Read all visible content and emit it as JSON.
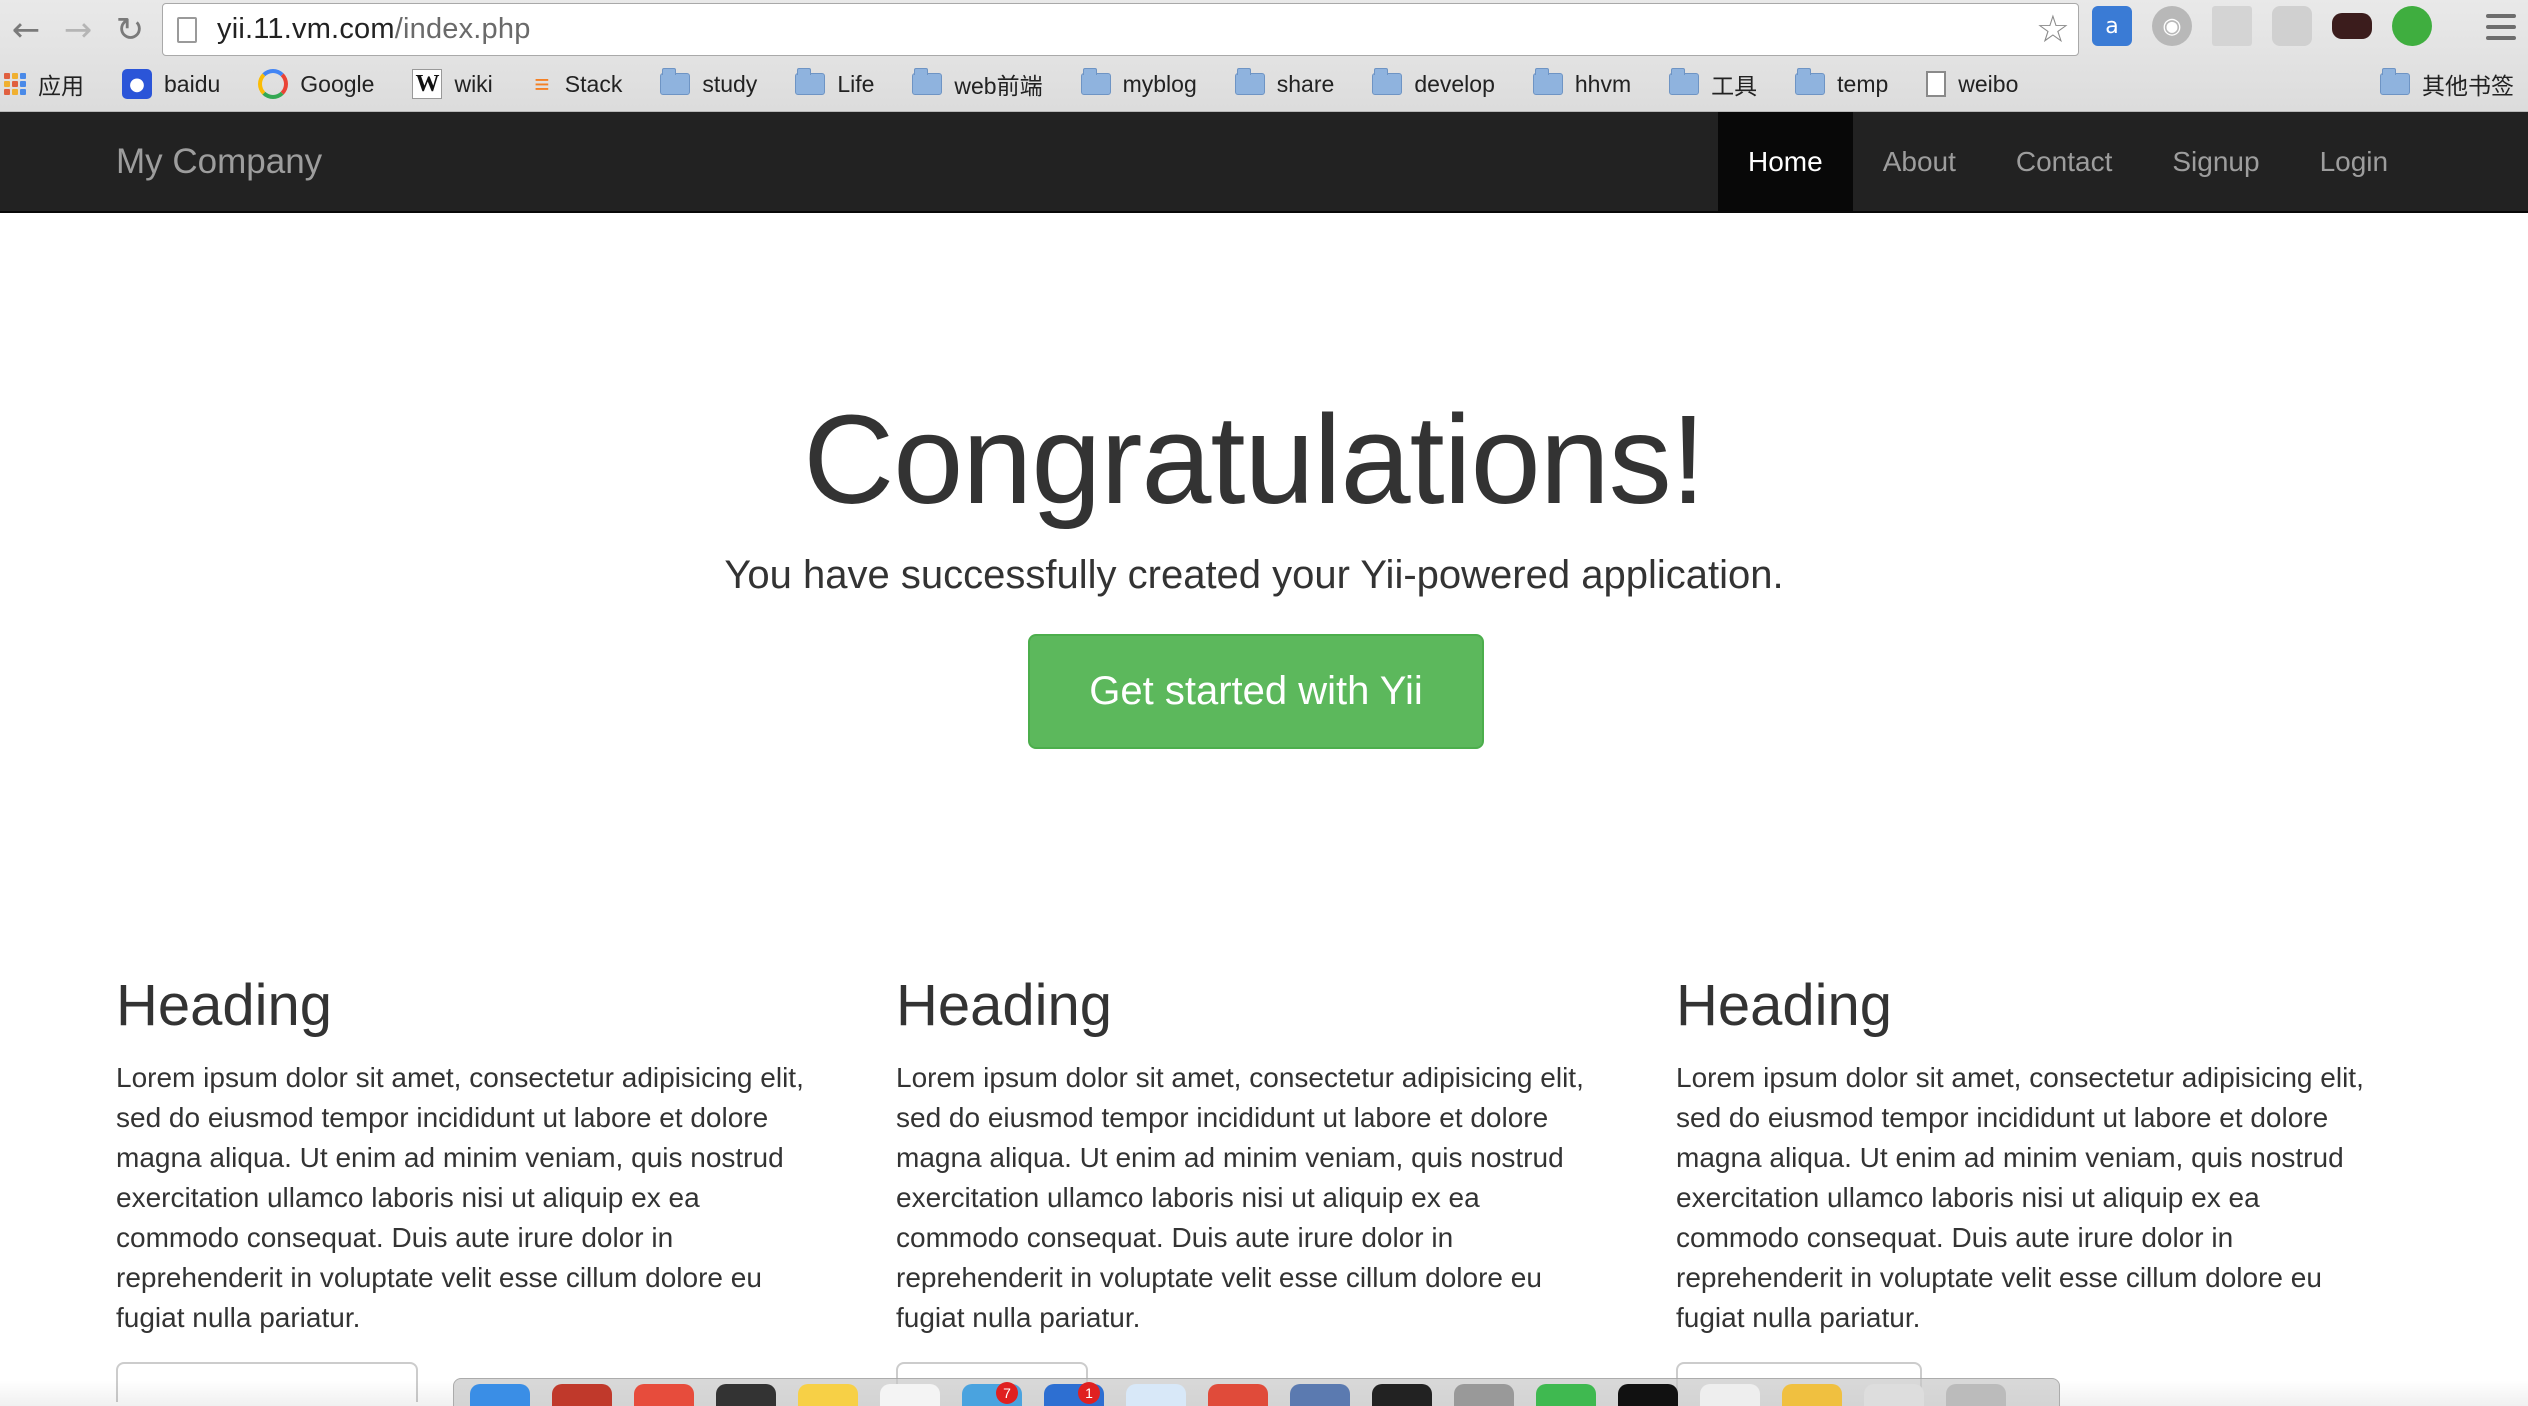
{
  "browser": {
    "url_host": "yii.11.vm.com",
    "url_path": "/index.php",
    "bookmarks": [
      {
        "label": "应用",
        "icon": "apps-icon"
      },
      {
        "label": "baidu",
        "icon": "baidu-icon"
      },
      {
        "label": "Google",
        "icon": "google-icon"
      },
      {
        "label": "wiki",
        "icon": "wikipedia-icon"
      },
      {
        "label": "Stack",
        "icon": "stackoverflow-icon"
      },
      {
        "label": "study",
        "icon": "folder-icon"
      },
      {
        "label": "Life",
        "icon": "folder-icon"
      },
      {
        "label": "web前端",
        "icon": "folder-icon"
      },
      {
        "label": "myblog",
        "icon": "folder-icon"
      },
      {
        "label": "share",
        "icon": "folder-icon"
      },
      {
        "label": "develop",
        "icon": "folder-icon"
      },
      {
        "label": "hhvm",
        "icon": "folder-icon"
      },
      {
        "label": "工具",
        "icon": "folder-icon"
      },
      {
        "label": "temp",
        "icon": "folder-icon"
      },
      {
        "label": "weibo",
        "icon": "page-icon"
      }
    ],
    "other_bookmarks": "其他书签"
  },
  "navbar": {
    "brand": "My Company",
    "links": [
      {
        "label": "Home",
        "active": true
      },
      {
        "label": "About",
        "active": false
      },
      {
        "label": "Contact",
        "active": false
      },
      {
        "label": "Signup",
        "active": false
      },
      {
        "label": "Login",
        "active": false
      }
    ]
  },
  "jumbotron": {
    "title": "Congratulations!",
    "lead": "You have successfully created your Yii-powered application.",
    "cta": "Get started with Yii"
  },
  "columns": [
    {
      "heading": "Heading",
      "body": "Lorem ipsum dolor sit amet, consectetur adipisicing elit, sed do eiusmod tempor incididunt ut labore et dolore magna aliqua. Ut enim ad minim veniam, quis nostrud exercitation ullamco laboris nisi ut aliquip ex ea commodo consequat. Duis aute irure dolor in reprehenderit in voluptate velit esse cillum dolore eu fugiat nulla pariatur."
    },
    {
      "heading": "Heading",
      "body": "Lorem ipsum dolor sit amet, consectetur adipisicing elit, sed do eiusmod tempor incididunt ut labore et dolore magna aliqua. Ut enim ad minim veniam, quis nostrud exercitation ullamco laboris nisi ut aliquip ex ea commodo consequat. Duis aute irure dolor in reprehenderit in voluptate velit esse cillum dolore eu fugiat nulla pariatur."
    },
    {
      "heading": "Heading",
      "body": "Lorem ipsum dolor sit amet, consectetur adipisicing elit, sed do eiusmod tempor incididunt ut labore et dolore magna aliqua. Ut enim ad minim veniam, quis nostrud exercitation ullamco laboris nisi ut aliquip ex ea commodo consequat. Duis aute irure dolor in reprehenderit in voluptate velit esse cillum dolore eu fugiat nulla pariatur."
    }
  ],
  "dock": {
    "badges": [
      "7",
      "1"
    ]
  },
  "colors": {
    "navbar_bg": "#222222",
    "navbar_active_bg": "#080808",
    "navbar_text": "#9d9d9d",
    "success": "#5cb85c"
  }
}
